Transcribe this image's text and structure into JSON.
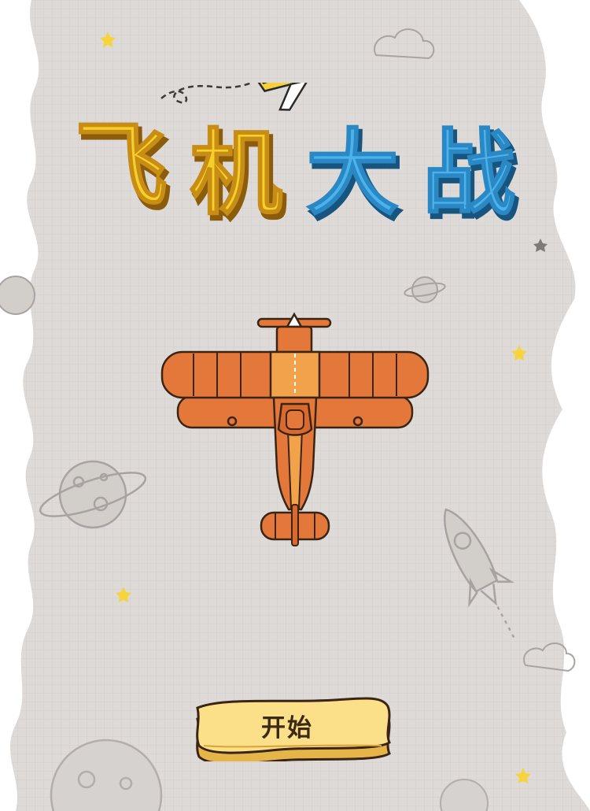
{
  "game": {
    "title": "飞机大战",
    "title_chars": [
      "飞",
      "机",
      "大",
      "战"
    ],
    "start_button_label": "开始"
  },
  "colors": {
    "paper": "#dedad8",
    "grid_line": "#cfcac7",
    "margin_white": "#ffffff",
    "title_yellow": "#f7cf2a",
    "title_blue": "#4bb2ec",
    "plane_orange": "#e4783a",
    "plane_light": "#f2a24a",
    "outline": "#3a2414",
    "button_fill": "#fbe089",
    "star_yellow": "#f7d33c"
  },
  "icons": [
    "plane-icon",
    "rocket-icon",
    "planet-icon",
    "cloud-icon",
    "star-icon"
  ]
}
